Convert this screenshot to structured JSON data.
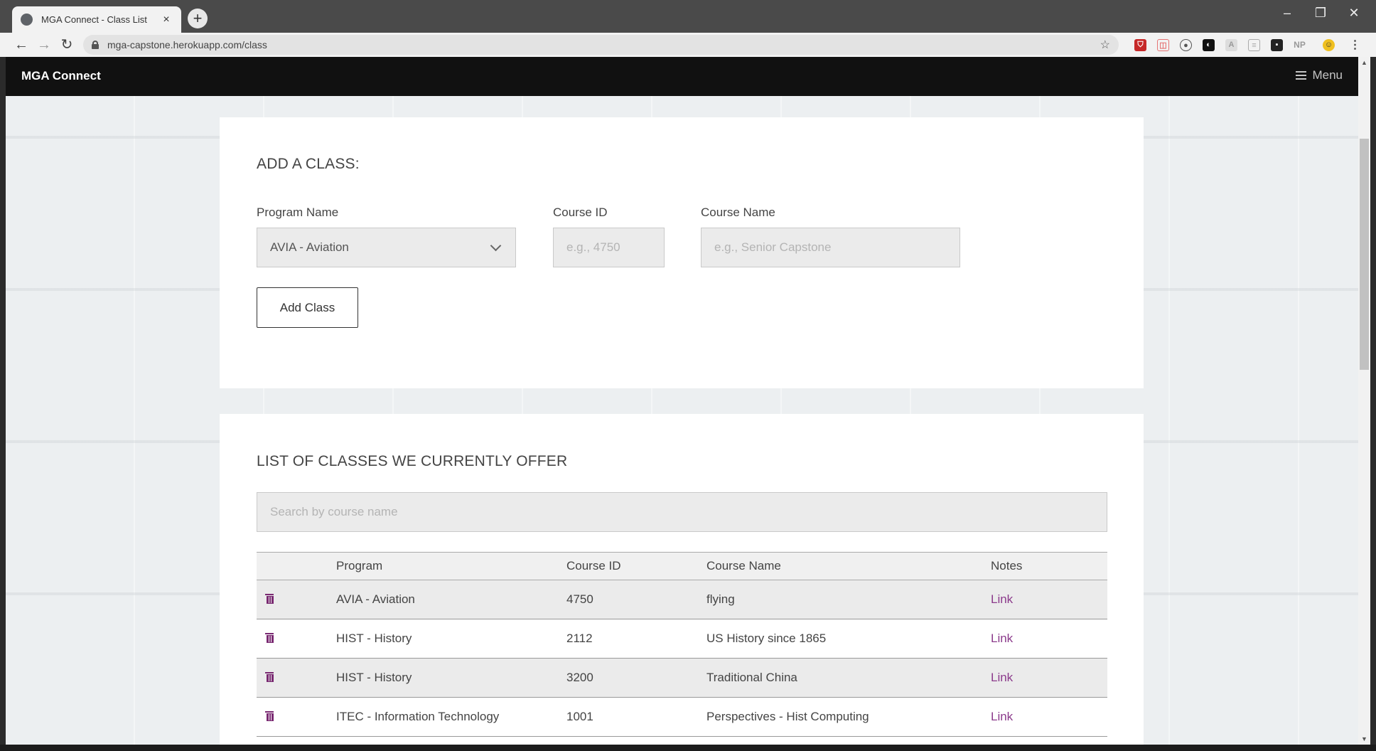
{
  "browser": {
    "tab_title": "MGA Connect - Class List",
    "url": "mga-capstone.herokuapp.com/class",
    "new_tab": "+",
    "close_tab": "×",
    "extensions": [
      "NP"
    ]
  },
  "navbar": {
    "brand": "MGA Connect",
    "menu_label": "Menu"
  },
  "add_class": {
    "heading": "ADD A CLASS:",
    "program_label": "Program Name",
    "program_value": "AVIA - Aviation",
    "course_id_label": "Course ID",
    "course_id_placeholder": "e.g., 4750",
    "course_name_label": "Course Name",
    "course_name_placeholder": "e.g., Senior Capstone",
    "button_label": "Add Class"
  },
  "class_list": {
    "heading": "LIST OF CLASSES WE CURRENTLY OFFER",
    "search_placeholder": "Search by course name",
    "columns": [
      "",
      "Program",
      "Course ID",
      "Course Name",
      "Notes"
    ],
    "rows": [
      {
        "program": "AVIA - Aviation",
        "course_id": "4750",
        "course_name": "flying",
        "notes": "Link"
      },
      {
        "program": "HIST - History",
        "course_id": "2112",
        "course_name": "US History since 1865",
        "notes": "Link"
      },
      {
        "program": "HIST - History",
        "course_id": "3200",
        "course_name": "Traditional China",
        "notes": "Link"
      },
      {
        "program": "ITEC - Information Technology",
        "course_id": "1001",
        "course_name": "Perspectives - Hist Computing",
        "notes": "Link"
      }
    ]
  },
  "colors": {
    "navbar": "#111111",
    "accent_link": "#8b3a8b",
    "trash": "#7a2a72"
  }
}
